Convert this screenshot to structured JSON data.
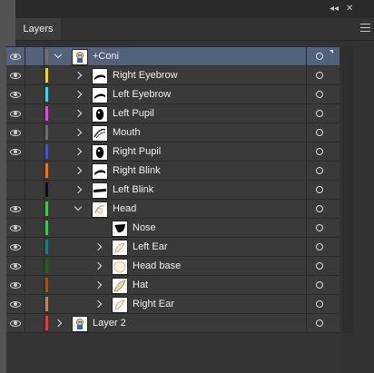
{
  "window": {
    "collapse_glyph": "◂◂",
    "close_glyph": "✕"
  },
  "panel": {
    "tab_label": "Layers",
    "menu_icon": "hamburger-menu-icon"
  },
  "layers": [
    {
      "name": "+Coni",
      "visible": true,
      "color": "#6e6e6e",
      "level": 0,
      "expander": "down",
      "selected": true,
      "thumb": "character"
    },
    {
      "name": "Right Eyebrow",
      "visible": true,
      "color": "#e8d23a",
      "level": 1,
      "expander": "right",
      "thumb": "brow"
    },
    {
      "name": "Left Eyebrow",
      "visible": true,
      "color": "#45d3df",
      "level": 1,
      "expander": "right",
      "thumb": "brow"
    },
    {
      "name": "Left Pupil",
      "visible": true,
      "color": "#d44fd6",
      "level": 1,
      "expander": "right",
      "thumb": "pupil"
    },
    {
      "name": "Mouth",
      "visible": true,
      "color": "#6c6c6c",
      "level": 1,
      "expander": "right",
      "thumb": "mouth"
    },
    {
      "name": "Right Pupil",
      "visible": true,
      "color": "#4c4fd4",
      "level": 1,
      "expander": "right",
      "thumb": "pupil"
    },
    {
      "name": "Right Blink",
      "visible": false,
      "color": "#e07a22",
      "level": 1,
      "expander": "right",
      "thumb": "brow"
    },
    {
      "name": "Left Blink",
      "visible": false,
      "color": "#0c0c0c",
      "level": 1,
      "expander": "right",
      "thumb": "blink"
    },
    {
      "name": "Head",
      "visible": true,
      "color": "#41c450",
      "level": 1,
      "expander": "down",
      "thumb": "head"
    },
    {
      "name": "Nose",
      "visible": true,
      "color": "#41c450",
      "level": 2,
      "expander": "none",
      "thumb": "nose"
    },
    {
      "name": "Left Ear",
      "visible": true,
      "color": "#1f7d7d",
      "level": 2,
      "expander": "right",
      "thumb": "ear"
    },
    {
      "name": "Head base",
      "visible": true,
      "color": "#2b5a1e",
      "level": 2,
      "expander": "right",
      "thumb": "headbase"
    },
    {
      "name": "Hat",
      "visible": true,
      "color": "#9a5514",
      "level": 2,
      "expander": "right",
      "thumb": "hat"
    },
    {
      "name": "Right Ear",
      "visible": true,
      "color": "#b58a66",
      "level": 2,
      "expander": "right",
      "thumb": "ear"
    },
    {
      "name": "Layer 2",
      "visible": true,
      "color": "#d24040",
      "level": 0,
      "expander": "right",
      "thumb": "character"
    }
  ]
}
